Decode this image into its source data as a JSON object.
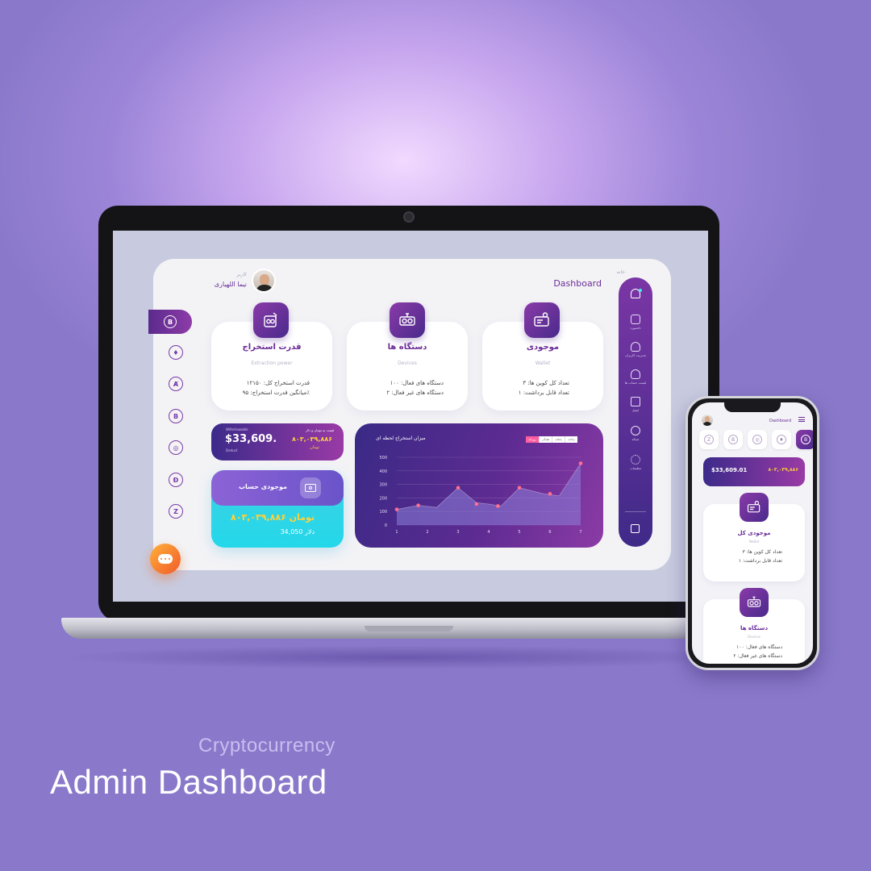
{
  "caption": {
    "subtitle": "Cryptocurrency",
    "title": "Admin Dashboard"
  },
  "dashboard": {
    "breadcrumb": "خانه",
    "page_title": "Dashboard",
    "user": {
      "role": "کاربر",
      "name": "نیما اللهیاری"
    },
    "side_coins": [
      "bitcoin",
      "ethereum",
      "algorand",
      "bitcoin-alt",
      "coin",
      "dogecoin",
      "zcash"
    ],
    "nav": [
      {
        "icon": "home-icon",
        "label": "داشبورد"
      },
      {
        "icon": "user-icon",
        "label": "مدیریت کاربران"
      },
      {
        "icon": "users-icon",
        "label": "لیست حساب ها"
      },
      {
        "icon": "mail-icon",
        "label": "ایمیل"
      },
      {
        "icon": "globe-icon",
        "label": "شبکه"
      },
      {
        "icon": "gear-icon",
        "label": "تنظیمات"
      }
    ],
    "stats": {
      "power": {
        "title": "قدرت استخراج",
        "subtitle": "Extraction power",
        "line1": "قدرت استخراج کل: ۱۲۱۵۰",
        "line2": "میانگین قدرت استخراج: ۹۵٪"
      },
      "devices": {
        "title": "دستگاه ها",
        "subtitle": "Devices",
        "line1": "دستگاه های فعال: ۱۰۰",
        "line2": "دستگاه های غیر فعال: ۲"
      },
      "wallet": {
        "title": "موجودی",
        "subtitle": "Wallet",
        "line1": "تعداد کل کوین ها: ۳",
        "line2": "تعداد قابل برداشت: ۱"
      }
    },
    "balance": {
      "label_left": "Withdrawable",
      "amount_usd": "$33,609.",
      "caption_left": "Deduct",
      "label_right": "قیمت به تومان و دلار",
      "amount_toman": "۸۰۳,۰۳۹,۸۸۶",
      "currency": "تومان"
    },
    "account": {
      "title": "موجودی حساب",
      "toman": "تومان ۸۰۳,۰۳۹,۸۸۶",
      "dollar": "دلار 34,050"
    },
    "chart_title": "میزان استخراج لحظه ای",
    "chart_filters": [
      "روزانه",
      "هفتگی",
      "ماهانه",
      "سالانه"
    ],
    "chart_data": {
      "type": "area",
      "title": "میزان استخراج لحظه ای",
      "x": [
        1,
        1.7,
        2.3,
        3,
        3.6,
        4,
        4.4,
        5,
        5.8,
        6.3,
        7
      ],
      "y": [
        115,
        145,
        130,
        275,
        165,
        155,
        140,
        275,
        230,
        215,
        455
      ],
      "points_marked_x": [
        1,
        1.7,
        3,
        3.6,
        4.3,
        5,
        6,
        7
      ],
      "points_marked_y": [
        115,
        145,
        275,
        155,
        140,
        275,
        230,
        455
      ],
      "xticks": [
        1,
        2,
        3,
        4,
        5,
        6,
        7
      ],
      "yticks": [
        0,
        100,
        200,
        300,
        400,
        500
      ],
      "xlim": [
        1,
        7
      ],
      "ylim": [
        0,
        500
      ],
      "grid": true,
      "colors": {
        "area": "#8c7fd8",
        "line": "#e0607c",
        "points": "#ff6f8e"
      }
    }
  },
  "phone": {
    "page_title": "Dashboard",
    "balance_usd": "$33,609.01",
    "balance_toman": "۸۰۳,۰۳۹,۸۸۶",
    "wallet_card": {
      "title": "موجودی کل",
      "subtitle": "Wallet",
      "line1": "تعداد کل کوین ها: ۳",
      "line2": "تعداد قابل برداشت: ۱"
    },
    "devices_card": {
      "title": "دستگاه ها",
      "subtitle": "Devices",
      "line1": "دستگاه های فعال: ۱۰۰",
      "line2": "دستگاه های غیر فعال: ۲"
    }
  },
  "colors": {
    "background": "#9c85d8",
    "brand_purple": "#6a2e96",
    "accent_yellow": "#ffd23a",
    "accent_cyan": "#23d8ea"
  }
}
